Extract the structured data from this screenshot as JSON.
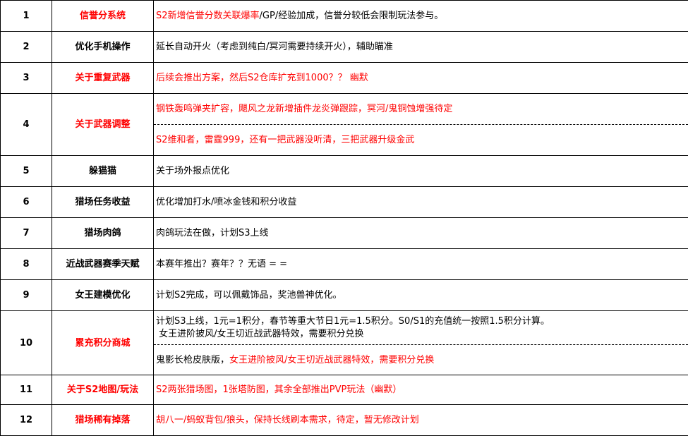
{
  "colors": {
    "highlight": "#ff0000",
    "text": "#000000",
    "border": "#000000",
    "background": "#ffffff"
  },
  "rows": [
    {
      "num": "1",
      "topic": "信誉分系统",
      "topic_red": true,
      "desc": [
        [
          {
            "text": "S2新增信誉分数关联爆率",
            "red": true
          },
          {
            "text": "/GP/经验加成，信誉分较低会限制玩法参与。",
            "red": false
          }
        ]
      ]
    },
    {
      "num": "2",
      "topic": "优化手机操作",
      "topic_red": false,
      "desc": [
        [
          {
            "text": "延长自动开火（考虑到纯白/冥河需要持续开火），辅助瞄准",
            "red": false
          }
        ]
      ]
    },
    {
      "num": "3",
      "topic": "关于重复武器",
      "topic_red": true,
      "desc": [
        [
          {
            "text": "后续会推出方案，然后S2仓库扩充到1000？？ 幽默",
            "red": true
          }
        ]
      ]
    },
    {
      "num": "4",
      "topic": "关于武器调整",
      "topic_red": true,
      "desc": [
        [
          {
            "text": "钢铁轰鸣弹夹扩容，飓风之龙新增插件龙炎弹跟踪，冥河/鬼铜蚀增强待定",
            "red": true
          }
        ],
        [
          {
            "text": "S2维和者，雷霆999，还有一把武器没听清，三把武器升级金武",
            "red": true
          }
        ]
      ]
    },
    {
      "num": "5",
      "topic": "躲猫猫",
      "topic_red": false,
      "desc": [
        [
          {
            "text": "关于场外报点优化",
            "red": false
          }
        ]
      ]
    },
    {
      "num": "6",
      "topic": "猎场任务收益",
      "topic_red": false,
      "desc": [
        [
          {
            "text": "优化增加打水/喷冰金钱和积分收益",
            "red": false
          }
        ]
      ]
    },
    {
      "num": "7",
      "topic": "猎场肉鸽",
      "topic_red": false,
      "desc": [
        [
          {
            "text": "肉鸽玩法在做，计划S3上线",
            "red": false
          }
        ]
      ]
    },
    {
      "num": "8",
      "topic": "近战武器赛季天赋",
      "topic_red": false,
      "desc": [
        [
          {
            "text": "本赛年推出？赛年？？无语 = =",
            "red": false
          }
        ]
      ]
    },
    {
      "num": "9",
      "topic": "女王建模优化",
      "topic_red": false,
      "desc": [
        [
          {
            "text": "计划S2完成，可以佩戴饰品，奖池兽神优化。",
            "red": false
          }
        ]
      ]
    },
    {
      "num": "10",
      "topic": "累充积分商城",
      "topic_red": true,
      "desc": [
        [
          {
            "text": "计划S3上线，1元=1积分，春节等重大节日1元=1.5积分。S0/S1的充值统一按照1.5积分计算。",
            "red": false
          }
        ],
        [
          {
            "text": " 女王进阶披风/女王切近战武器特效，需要积分兑换",
            "red": false
          }
        ],
        [
          {
            "text": "鬼影长枪皮肤版，",
            "red": false
          },
          {
            "text": "女王进阶披风/女王切近战武器特效，需要积分兑换",
            "red": true
          }
        ]
      ]
    },
    {
      "num": "11",
      "topic": "关于S2地图/玩法",
      "topic_red": true,
      "desc": [
        [
          {
            "text": "S2两张猎场图，1张塔防图，其余全部推出PVP玩法（幽默）",
            "red": true
          }
        ]
      ]
    },
    {
      "num": "12",
      "topic": "猎场稀有掉落",
      "topic_red": true,
      "desc": [
        [
          {
            "text": "胡八一/蚂蚁背包/狼头，保持长线刷本需求，待定，暂无修改计划",
            "red": true
          }
        ]
      ]
    }
  ]
}
